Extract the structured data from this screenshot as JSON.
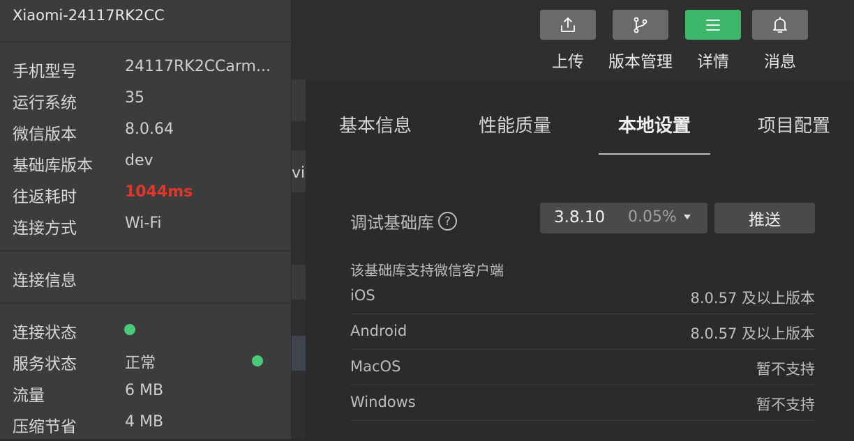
{
  "toolbar": {
    "buttons": [
      {
        "label": "上传",
        "icon": "upload-icon",
        "active": false
      },
      {
        "label": "版本管理",
        "icon": "branch-icon",
        "active": false
      },
      {
        "label": "详情",
        "icon": "menu-icon",
        "active": true
      },
      {
        "label": "消息",
        "icon": "bell-icon",
        "active": false
      }
    ]
  },
  "background": {
    "partial_text": "vi"
  },
  "device": {
    "title": "Xiaomi-24117RK2CC",
    "info": [
      {
        "label": "手机型号",
        "value": "24117RK2CCarm..."
      },
      {
        "label": "运行系统",
        "value": "35"
      },
      {
        "label": "微信版本",
        "value": "8.0.64"
      },
      {
        "label": "基础库版本",
        "value": "dev"
      },
      {
        "label": "往返耗时",
        "value": "1044ms"
      },
      {
        "label": "连接方式",
        "value": "Wi-Fi"
      }
    ],
    "connection_section_title": "连接信息",
    "connection": [
      {
        "label": "连接状态",
        "value": ""
      },
      {
        "label": "服务状态",
        "value": "正常"
      },
      {
        "label": "流量",
        "value": "6 MB"
      },
      {
        "label": "压缩节省",
        "value": "4 MB"
      }
    ]
  },
  "details": {
    "tabs": [
      {
        "label": "基本信息",
        "active": false
      },
      {
        "label": "性能质量",
        "active": false
      },
      {
        "label": "本地设置",
        "active": true
      },
      {
        "label": "项目配置",
        "active": false
      }
    ],
    "debug_lib": {
      "label": "调试基础库",
      "help_symbol": "?",
      "version": "3.8.10",
      "percent": "0.05%",
      "push_label": "推送"
    },
    "support": {
      "title": "该基础库支持微信客户端",
      "rows": [
        {
          "platform": "iOS",
          "status": "8.0.57 及以上版本"
        },
        {
          "platform": "Android",
          "status": "8.0.57 及以上版本"
        },
        {
          "platform": "MacOS",
          "status": "暂不支持"
        },
        {
          "platform": "Windows",
          "status": "暂不支持"
        }
      ]
    }
  },
  "colors": {
    "accent_green": "#3db669",
    "status_dot": "#4bc97a",
    "warning_red": "#e0362c"
  }
}
